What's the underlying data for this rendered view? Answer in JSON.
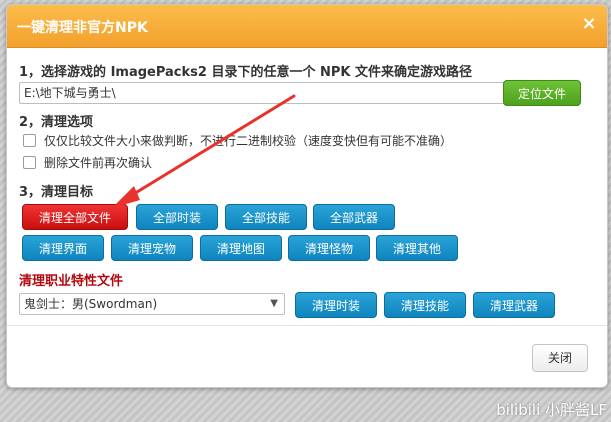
{
  "dialog": {
    "title": "一键清理非官方NPK",
    "close_icon": "×"
  },
  "step1": {
    "heading": "1，选择游戏的 ImagePacks2 目录下的任意一个 NPK 文件来确定游戏路径",
    "path_value": "E:\\地下城与勇士\\",
    "locate_button": "定位文件"
  },
  "step2": {
    "heading": "2，清理选项",
    "options": [
      "仅仅比较文件大小来做判断，不进行二进制校验（速度变快但有可能不准确）",
      "删除文件前再次确认"
    ]
  },
  "step3": {
    "heading": "3，清理目标",
    "row1": [
      "清理全部文件",
      "全部时装",
      "全部技能",
      "全部武器"
    ],
    "row2": [
      "清理界面",
      "清理宠物",
      "清理地图",
      "清理怪物",
      "清理其他"
    ]
  },
  "job": {
    "heading": "清理职业特性文件",
    "selected": "鬼剑士：男(Swordman)",
    "buttons": [
      "清理时装",
      "清理技能",
      "清理武器"
    ]
  },
  "footer": {
    "close_button": "关闭"
  },
  "watermark": "bilibili 小胖酱LF",
  "colors": {
    "title_orange": "#f3a02c",
    "accent_red": "#c80f0f",
    "button_blue": "#0f84bd",
    "button_green": "#4da11d",
    "annotation_arrow": "#e8322b"
  }
}
